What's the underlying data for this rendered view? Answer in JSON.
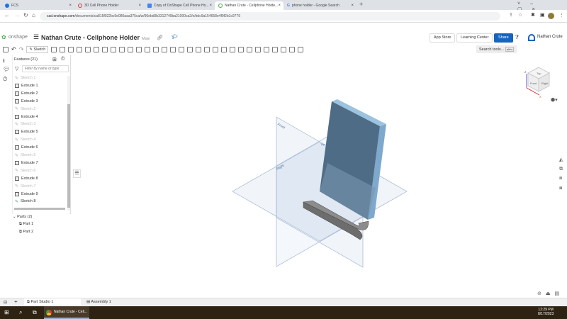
{
  "browser": {
    "tabs": [
      {
        "label": "FCS",
        "color": "#1a73e8"
      },
      {
        "label": "3D Cell Phone Holder",
        "color": "#e53935"
      },
      {
        "label": "Copy of OnShape Cell Phone Ho...",
        "color": "#4285f4"
      },
      {
        "label": "Nathan Crute - Cellphone Holde...",
        "color": "#4caf50"
      },
      {
        "label": "phone holder - Google Search",
        "color": "#888888"
      }
    ],
    "url_domain": "cad.onshape.com",
    "url_path": "/documents/ca815f022bc9e080aaa375ca/w/96ebd0b3312740ba21000ca2/e/bdc9a154658e4f9f2b1c9779"
  },
  "header": {
    "logo": "onshape",
    "doc_title": "Nathan Crute - Cellphone Holder",
    "branch": "Main",
    "app_store": "App Store",
    "learning_center": "Learning Center",
    "share": "Share",
    "user": "Nathan Crute",
    "accent": "#1565c0"
  },
  "toolbar": {
    "sketch": "Sketch",
    "search_placeholder": "Search tools...",
    "search_shortcut": "alt+c"
  },
  "features": {
    "title": "Features (21)",
    "filter_placeholder": "Filter by name or type",
    "items": [
      {
        "label": "Sketch 1",
        "type": "sketch"
      },
      {
        "label": "Extrude 1",
        "type": "extrude"
      },
      {
        "label": "Extrude 2",
        "type": "extrude"
      },
      {
        "label": "Extrude 3",
        "type": "extrude"
      },
      {
        "label": "Sketch 2",
        "type": "sketch"
      },
      {
        "label": "Extrude 4",
        "type": "extrude"
      },
      {
        "label": "Sketch 3",
        "type": "sketch"
      },
      {
        "label": "Extrude 5",
        "type": "extrude"
      },
      {
        "label": "Sketch 4",
        "type": "sketch"
      },
      {
        "label": "Extrude 6",
        "type": "extrude"
      },
      {
        "label": "Sketch 5",
        "type": "sketch"
      },
      {
        "label": "Extrude 7",
        "type": "extrude"
      },
      {
        "label": "Sketch 6",
        "type": "sketch"
      },
      {
        "label": "Extrude 8",
        "type": "extrude"
      },
      {
        "label": "Sketch 7",
        "type": "sketch"
      },
      {
        "label": "Extrude 9",
        "type": "extrude"
      },
      {
        "label": "Sketch 8",
        "type": "sketch-active"
      }
    ],
    "parts_title": "Parts (2)",
    "parts": [
      "Part 1",
      "Part 2"
    ]
  },
  "viewport": {
    "planes": [
      "Front",
      "Right",
      "Top"
    ],
    "cube": {
      "top": "Top",
      "front": "Front",
      "right": "Right",
      "axes": [
        "Z",
        "X"
      ]
    }
  },
  "bottom_tabs": [
    "Part Studio 1",
    "Assembly 1"
  ],
  "taskbar": {
    "app": "Nathan Crute - Cell...",
    "time": "12:29 PM",
    "date": "8/17/2023"
  }
}
